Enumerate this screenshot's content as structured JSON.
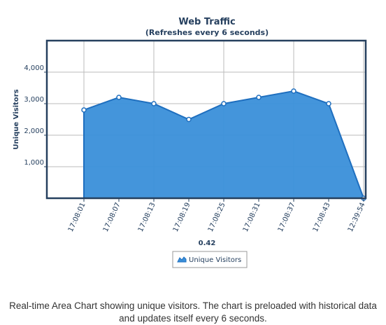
{
  "chart_data": {
    "type": "area",
    "title": "Web Traffic",
    "subtitle": "(Refreshes every 6 seconds)",
    "xlabel": "0.42",
    "ylabel": "Unique Visitors",
    "categories": [
      "17:08:01",
      "17:08:07",
      "17:08:13",
      "17:08:19",
      "17:08:25",
      "17:08:31",
      "17:08:37",
      "17:08:43",
      "12:39:54"
    ],
    "series": [
      {
        "name": "Unique Visitors",
        "values": [
          2800,
          3200,
          3000,
          2500,
          3000,
          3200,
          3400,
          3000,
          0
        ]
      }
    ],
    "ylim": [
      0,
      5000
    ],
    "yticks": [
      1000,
      2000,
      3000,
      4000
    ],
    "ytick_labels": [
      "1,000",
      "2,000",
      "3,000",
      "4,000"
    ],
    "grid": true,
    "legend_position": "bottom-center",
    "colors": {
      "fill": "#3a8fd9",
      "line": "#1f6fbf",
      "border": "#26405f",
      "text": "#26405f",
      "grid": "#bbbbbb"
    }
  },
  "caption": "Real-time Area Chart showing unique visitors. The chart is preloaded with historical data and updates itself every 6 seconds."
}
